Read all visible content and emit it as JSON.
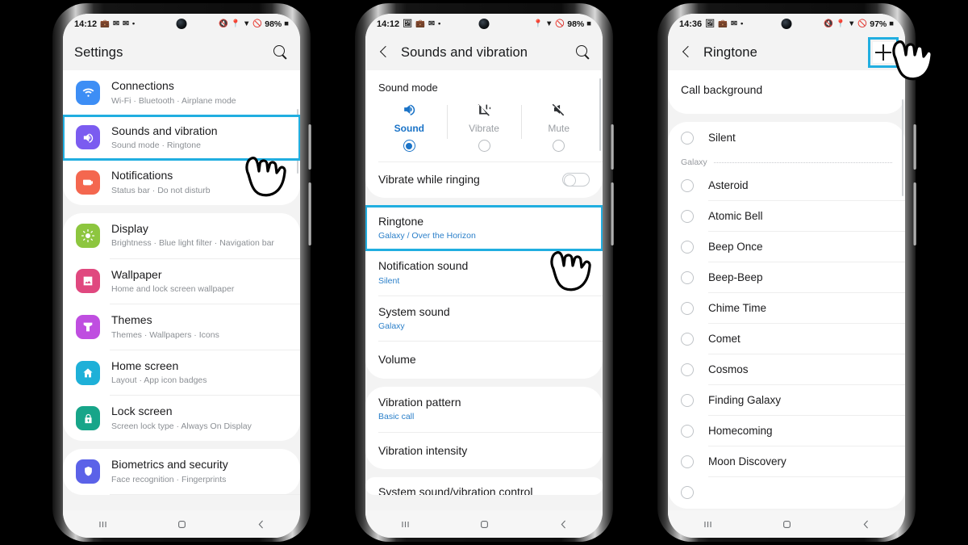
{
  "accent": "#21aee0",
  "link_blue": "#2a7fc9",
  "phone1": {
    "status": {
      "time": "14:12",
      "battery": "98%",
      "left_icons": [
        "briefcase-icon",
        "dual-message-icon",
        "mail-icon",
        "dot-icon"
      ],
      "right_icons": [
        "mute-icon",
        "location-icon",
        "wifi-icon",
        "dnd-icon"
      ]
    },
    "appbar": {
      "title": "Settings",
      "search_icon": "search-icon"
    },
    "items": [
      {
        "title": "Connections",
        "sub": "Wi-Fi  ·  Bluetooth  ·  Airplane mode",
        "color": "#3d8ef5",
        "icon": "wifi-icon",
        "selected": false
      },
      {
        "title": "Sounds and vibration",
        "sub": "Sound mode  ·  Ringtone",
        "color": "#7b5cf0",
        "icon": "speaker-icon",
        "selected": true
      },
      {
        "title": "Notifications",
        "sub": "Status bar  ·  Do not disturb",
        "color": "#f4674f",
        "icon": "bell-icon",
        "selected": false
      },
      {
        "title": "Display",
        "sub": "Brightness  ·  Blue light filter  ·  Navigation bar",
        "color": "#8dc63f",
        "icon": "brightness-icon",
        "selected": false
      },
      {
        "title": "Wallpaper",
        "sub": "Home and lock screen wallpaper",
        "color": "#e0487f",
        "icon": "image-icon",
        "selected": false
      },
      {
        "title": "Themes",
        "sub": "Themes  ·  Wallpapers  ·  Icons",
        "color": "#bf4ee0",
        "icon": "brush-icon",
        "selected": false
      },
      {
        "title": "Home screen",
        "sub": "Layout  ·  App icon badges",
        "color": "#1eb0d8",
        "icon": "home-icon",
        "selected": false
      },
      {
        "title": "Lock screen",
        "sub": "Screen lock type  ·  Always On Display",
        "color": "#17a589",
        "icon": "lock-icon",
        "selected": false
      },
      {
        "title": "Biometrics and security",
        "sub": "Face recognition  ·  Fingerprints",
        "color": "#5b62e8",
        "icon": "shield-icon",
        "selected": false
      }
    ],
    "nav": {
      "recents": "recents-icon",
      "home": "home-icon",
      "back": "back-icon"
    }
  },
  "phone2": {
    "status": {
      "time": "14:12",
      "battery": "98%"
    },
    "appbar": {
      "title": "Sounds and vibration",
      "back_icon": "back-chevron-icon",
      "search_icon": "search-icon"
    },
    "sound_mode": {
      "label": "Sound mode",
      "modes": [
        {
          "label": "Sound",
          "icon": "speaker-on-icon",
          "selected": true
        },
        {
          "label": "Vibrate",
          "icon": "vibrate-icon",
          "selected": false
        },
        {
          "label": "Mute",
          "icon": "speaker-mute-icon",
          "selected": false
        }
      ]
    },
    "vibrate_while_ringing": {
      "label": "Vibrate while ringing",
      "toggle_on": false
    },
    "items": [
      {
        "title": "Ringtone",
        "sub": "Galaxy / Over the Horizon",
        "selected": true
      },
      {
        "title": "Notification sound",
        "sub": "Silent",
        "selected": false
      },
      {
        "title": "System sound",
        "sub": "Galaxy",
        "selected": false
      },
      {
        "title": "Volume",
        "sub": "",
        "selected": false
      }
    ],
    "items2": [
      {
        "title": "Vibration pattern",
        "sub": "Basic call"
      },
      {
        "title": "Vibration intensity",
        "sub": ""
      }
    ],
    "cut_item": "System sound/vibration control"
  },
  "phone3": {
    "status": {
      "time": "14:36",
      "battery": "97%"
    },
    "appbar": {
      "title": "Ringtone",
      "back_icon": "back-chevron-icon",
      "add_icon": "plus-icon"
    },
    "call_background": "Call background",
    "silent": "Silent",
    "group_label": "Galaxy",
    "ringtones": [
      "Asteroid",
      "Atomic Bell",
      "Beep Once",
      "Beep-Beep",
      "Chime Time",
      "Comet",
      "Cosmos",
      "Finding Galaxy",
      "Homecoming",
      "Moon Discovery"
    ]
  }
}
